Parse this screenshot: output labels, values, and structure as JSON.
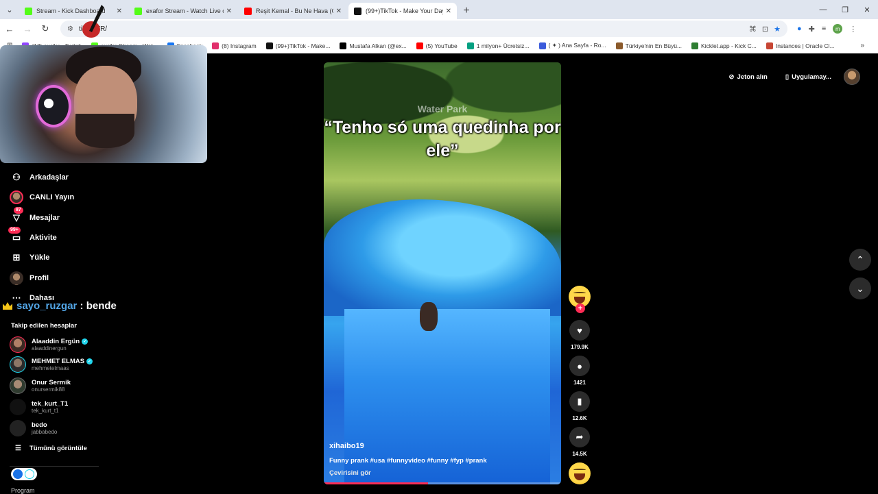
{
  "browser": {
    "tabs": [
      {
        "title": "Stream - Kick Dashboard",
        "fav_color": "#53fc18",
        "active": false
      },
      {
        "title": "exafor Stream - Watch Live on Kick",
        "fav_color": "#53fc18",
        "active": false
      },
      {
        "title": "Reşit Kemal - Bu Ne Hava (Official",
        "fav_color": "#ff0000",
        "active": false
      },
      {
        "title": "(99+)TikTok - Make Your Day",
        "fav_color": "#111111",
        "active": true
      }
    ],
    "url": "tik      /tr-TR/",
    "bookmarks": [
      {
        "label": "(12) exafor - Twitch",
        "color": "#9146ff"
      },
      {
        "label": "exafor Stream - Wat...",
        "color": "#53fc18"
      },
      {
        "label": "Facebook",
        "color": "#1877f2"
      },
      {
        "label": "(8) Instagram",
        "color": "#e1306c"
      },
      {
        "label": "(99+)TikTok - Make...",
        "color": "#111111"
      },
      {
        "label": "Mustafa Alkan (@ex...",
        "color": "#000000"
      },
      {
        "label": "(5) YouTube",
        "color": "#ff0000"
      },
      {
        "label": "1 milyon+ Ücretsiz...",
        "color": "#05a081"
      },
      {
        "label": "( ✦ ) Ana Sayfa - Ro...",
        "color": "#3b5bdb"
      },
      {
        "label": "Türkiye'nin En Büyü...",
        "color": "#8b5a2b"
      },
      {
        "label": "Kicklet.app - Kick C...",
        "color": "#2e7d32"
      },
      {
        "label": "Instances | Oracle Cl...",
        "color": "#c74634"
      }
    ]
  },
  "sidebar": {
    "items": [
      {
        "label": "Arkadaşlar",
        "icon": "friends-icon"
      },
      {
        "label": "CANLI Yayın",
        "icon": "live-icon"
      },
      {
        "label": "Mesajlar",
        "icon": "messages-icon",
        "badge": "87"
      },
      {
        "label": "Aktivite",
        "icon": "activity-icon",
        "badge": "99+"
      },
      {
        "label": "Yükle",
        "icon": "upload-icon"
      },
      {
        "label": "Profil",
        "icon": "profile-icon"
      },
      {
        "label": "Dahası",
        "icon": "more-icon"
      }
    ],
    "chat": {
      "user": "sayo_ruzgar",
      "text": " : bende"
    },
    "following_title": "Takip edilen hesaplar",
    "following": [
      {
        "name": "Alaaddin Ergün",
        "user": "alaaddinergun",
        "verified": true
      },
      {
        "name": "MEHMET ELMAS",
        "user": "mehmetelmaas",
        "verified": true
      },
      {
        "name": "Onur Sermik",
        "user": "onursermik88",
        "verified": false
      },
      {
        "name": "tek_kurt_T1",
        "user": "tek_kurt_t1",
        "verified": false
      },
      {
        "name": "bedo",
        "user": "jabbabedo",
        "verified": false
      }
    ],
    "see_all": "Tümünü görüntüle",
    "program": "Program"
  },
  "video": {
    "watermark": "Water Park",
    "caption": "“Tenho só uma quedinha por ele”",
    "author": "xihaibo19",
    "description": "Funny prank #usa #funnyvideo #funny #fyp #prank",
    "translate": "Çevirisini gör",
    "progress": 0.44
  },
  "actions": {
    "likes": "179.9K",
    "comments": "1421",
    "saves": "12.6K",
    "shares": "14.5K"
  },
  "topbar": {
    "coins": "Jeton alın",
    "app": "Uygulamay..."
  }
}
